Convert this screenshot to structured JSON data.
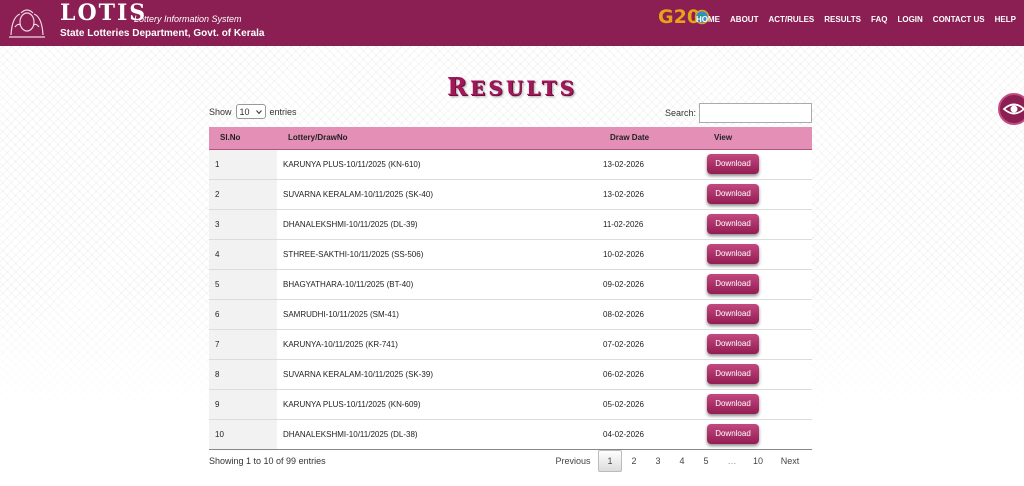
{
  "header": {
    "logo_text": "LOTIS",
    "tagline": "Lottery Information System",
    "department": "State Lotteries Department, Govt. of Kerala",
    "badge": "G20",
    "nav": [
      "HOME",
      "ABOUT",
      "ACT/RULES",
      "RESULTS",
      "FAQ",
      "LOGIN",
      "CONTACT US",
      "HELP"
    ]
  },
  "title": {
    "first": "R",
    "rest": "ESULTS"
  },
  "controls": {
    "show_label": "Show",
    "entries_value": "10",
    "entries_label": "entries",
    "search_label": "Search:",
    "search_value": ""
  },
  "table": {
    "columns": [
      "Sl.No",
      "Lottery/DrawNo",
      "Draw Date",
      "View"
    ],
    "rows": [
      {
        "sl": "1",
        "lottery": "KARUNYA PLUS-10/11/2025 (KN-610)",
        "date": "13-02-2026",
        "action": "Download"
      },
      {
        "sl": "2",
        "lottery": "SUVARNA KERALAM-10/11/2025 (SK-40)",
        "date": "13-02-2026",
        "action": "Download"
      },
      {
        "sl": "3",
        "lottery": "DHANALEKSHMI-10/11/2025 (DL-39)",
        "date": "11-02-2026",
        "action": "Download"
      },
      {
        "sl": "4",
        "lottery": "STHREE-SAKTHI-10/11/2025 (SS-506)",
        "date": "10-02-2026",
        "action": "Download"
      },
      {
        "sl": "5",
        "lottery": "BHAGYATHARA-10/11/2025 (BT-40)",
        "date": "09-02-2026",
        "action": "Download"
      },
      {
        "sl": "6",
        "lottery": "SAMRUDHI-10/11/2025 (SM-41)",
        "date": "08-02-2026",
        "action": "Download"
      },
      {
        "sl": "7",
        "lottery": "KARUNYA-10/11/2025 (KR-741)",
        "date": "07-02-2026",
        "action": "Download"
      },
      {
        "sl": "8",
        "lottery": "SUVARNA KERALAM-10/11/2025 (SK-39)",
        "date": "06-02-2026",
        "action": "Download"
      },
      {
        "sl": "9",
        "lottery": "KARUNYA PLUS-10/11/2025 (KN-609)",
        "date": "05-02-2026",
        "action": "Download"
      },
      {
        "sl": "10",
        "lottery": "DHANALEKSHMI-10/11/2025 (DL-38)",
        "date": "04-02-2026",
        "action": "Download"
      }
    ]
  },
  "footer": {
    "info": "Showing 1 to 10 of 99 entries",
    "prev": "Previous",
    "pages": [
      "1",
      "2",
      "3",
      "4",
      "5"
    ],
    "ellipsis": "…",
    "last": "10",
    "next": "Next"
  },
  "colors": {
    "brand": "#8b1e52",
    "header_row": "#e48fb6",
    "button": "#a8275f",
    "title": "#a3165a"
  },
  "icons": {
    "emblem": "kerala-emblem-icon",
    "eye": "eye-icon",
    "dropdown": "chevron-down-icon"
  }
}
